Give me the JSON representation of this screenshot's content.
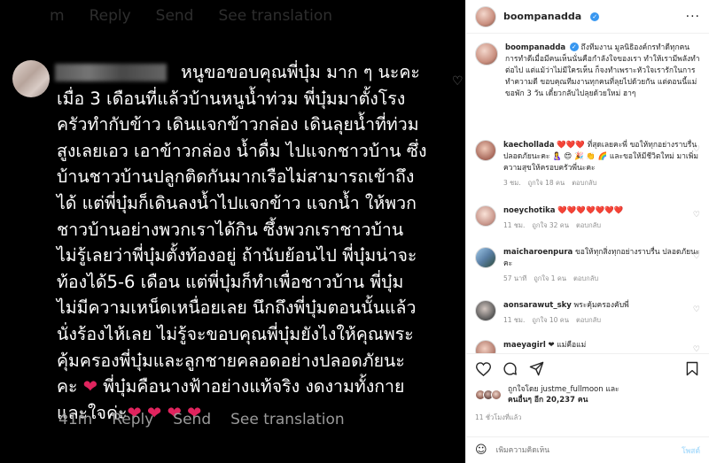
{
  "photo": {
    "ghost_row": [
      "m",
      "Reply",
      "Send",
      "See translation"
    ],
    "comment_lines": [
      "หนูขอขอบคุณพี่บุ๋ม มาก ๆ นะคะ",
      "เมื่อ 3 เดือนที่แล้วบ้านหนูน้ำท่วม พี่บุ๋มมาตั้งโรง",
      "ครัวทำกับข้าว เดินแจกข้าวกล่อง เดินลุยน้ำที่ท่วม",
      "สูงเลยเอว เอาข้าวกล่อง น้ำดื่ม ไปแจกชาวบ้าน ซึ่ง",
      "บ้านชาวบ้านปลูกติดกันมากเรือไม่สามารถเข้าถึง",
      "ได้ แต่พี่บุ๋มก็เดินลงน้ำไปแจกข้าว แจกน้ำ ให้พวก",
      "ชาวบ้านอย่างพวกเราได้กิน ซึ้งพวกเราชาวบ้าน",
      "ไม่รู้เลยว่าพี่บุ๋มตั้งท้องอยู่ ถ้านับย้อนไป พี่บุ๋มน่าจะ",
      "ท้องได้5-6 เดือน แต่พี่บุ๋มก็ทำเพื่อชาวบ้าน พี่บุ๋ม",
      "ไม่มีความเหน็ดเหนื่อยเลย นึกถึงพี่บุ๋มตอนนั้นแล้ว",
      "นั่งร้องไห้เลย ไม่รู้จะขอบคุณพี่บุ๋มยังไงให้คุณพระ",
      "คุ้มครองพี่บุ๋มและลูกชายคลอดอย่างปลอดภัยนะ"
    ],
    "comment_line_13a": "คะ",
    "comment_line_13b": "พี่บุ๋มคือนางฟ้าอย่างแท้จริง งดงามทั้งกาย",
    "comment_line_14": "และใจค่ะ",
    "heart": "❤",
    "meta": {
      "time": "41m",
      "reply": "Reply",
      "send": "Send",
      "translate": "See translation"
    }
  },
  "panel": {
    "header_username": "boompanadda",
    "caption": {
      "username": "boompanadda",
      "text": "ถึงทีมงาน มูลนิธิองค์กรทำดีทุกคน การทำดีเมื่อมีคนเห็นนั่นคือกำลังใจของเรา ทำให้เรามีพลังทำต่อไป แต่แม้ว่าไม่มีใครเห็น ก็จงทำเพราะหัวใจเรารักในการทำความดี ขอบคุณทีมงานทุกคนที่ลุยไปด้วยกัน แต่ตอนนี้แม่ขอพัก 3 วัน เดี๋ยวกลับไปลุยด้วยใหม่ ฮาๆ"
    },
    "comments": [
      {
        "username": "kaechollada",
        "text_a": "❤️❤️❤️ ที่สุดเลยคะพี่ ขอให้ทุกอย่างราบรื่น ปลอดภัยนะคะ 🤱 😍 🎉 👏 🌈 และขอให้มีชีวิตใหม่ มาเพิ่มความสุขให้ครอบครัวพี่นะคะ",
        "time": "3 ชม.",
        "likes": "ถูกใจ 18 คน",
        "reply": "ตอบกลับ"
      },
      {
        "username": "noeychotika",
        "text_a": "❤️❤️❤️❤️❤️❤️❤️",
        "time": "11 ชม.",
        "likes": "ถูกใจ 32 คน",
        "reply": "ตอบกลับ"
      },
      {
        "username": "maicharoenpura",
        "text_a": "ขอให้ทุกสิ่งทุกอย่างราบรื่น ปลอดภัยนะคะ",
        "time": "57 นาที",
        "likes": "ถูกใจ 1 คน",
        "reply": "ตอบกลับ"
      },
      {
        "username": "aonsarawut_sky",
        "text_a": "พระคุ้มครองคับพี่",
        "time": "11 ชม.",
        "likes": "ถูกใจ 10 คน",
        "reply": "ตอบกลับ"
      },
      {
        "username": "maeyagirl",
        "text_a": "❤ แม่คือแม่",
        "time": "",
        "likes": "",
        "reply": ""
      }
    ],
    "likes_line1": "ถูกใจโดย justme_fullmoon และ",
    "likes_line2": "คนอื่นๆ อีก 20,237 คน",
    "time_ago": "11 ชั่วโมงที่แล้ว",
    "add_comment_placeholder": "เพิ่มความคิดเห็น",
    "post_label": "โพสต์"
  }
}
